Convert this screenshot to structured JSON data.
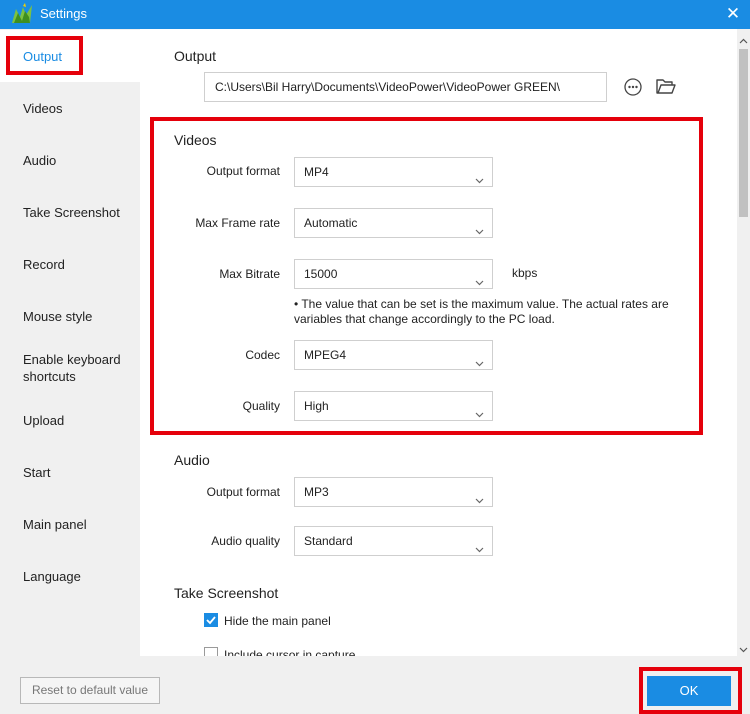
{
  "window": {
    "title": "Settings"
  },
  "sidebar": {
    "items": [
      {
        "label": "Output"
      },
      {
        "label": "Videos"
      },
      {
        "label": "Audio"
      },
      {
        "label": "Take Screenshot"
      },
      {
        "label": "Record"
      },
      {
        "label": "Mouse style"
      },
      {
        "label": "Enable keyboard shortcuts"
      },
      {
        "label": "Upload"
      },
      {
        "label": "Start"
      },
      {
        "label": "Main panel"
      },
      {
        "label": "Language"
      }
    ],
    "selected": "Output"
  },
  "output": {
    "title": "Output",
    "path": "C:\\Users\\Bil Harry\\Documents\\VideoPower\\VideoPower GREEN\\"
  },
  "videos": {
    "title": "Videos",
    "output_format_label": "Output format",
    "output_format_value": "MP4",
    "frame_rate_label": "Max Frame rate",
    "frame_rate_value": "Automatic",
    "bitrate_label": "Max Bitrate",
    "bitrate_value": "15000",
    "bitrate_unit": "kbps",
    "note": "• The value that can be set is the maximum value. The actual rates are variables that change accordingly to the PC load.",
    "codec_label": "Codec",
    "codec_value": "MPEG4",
    "quality_label": "Quality",
    "quality_value": "High"
  },
  "audio": {
    "title": "Audio",
    "output_format_label": "Output format",
    "output_format_value": "MP3",
    "quality_label": "Audio quality",
    "quality_value": "Standard"
  },
  "screenshot": {
    "title": "Take Screenshot",
    "hide_main_panel_label": "Hide the main panel",
    "hide_main_panel_checked": true,
    "include_cursor_label": "Include cursor in capture",
    "include_cursor_checked": false
  },
  "footer": {
    "reset_label": "Reset to default value",
    "ok_label": "OK"
  },
  "colors": {
    "accent": "#1a8ce3",
    "highlight": "#e5000b",
    "sidebar_bg": "#f0f0f0"
  }
}
